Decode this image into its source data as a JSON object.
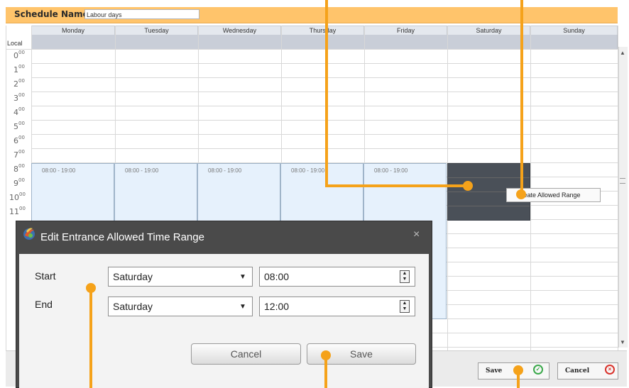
{
  "schedule": {
    "name_label": "Schedule Name:",
    "name_value": "Labour days"
  },
  "grid": {
    "local_label": "Local",
    "days": [
      "Monday",
      "Tuesday",
      "Wednesday",
      "Thursday",
      "Friday",
      "Saturday",
      "Sunday"
    ],
    "hours": [
      "0",
      "1",
      "2",
      "3",
      "4",
      "5",
      "6",
      "7",
      "8",
      "9",
      "10",
      "11"
    ],
    "hour_suffix": "00",
    "ranges": [
      {
        "day": "Monday",
        "label": "08:00 - 19:00"
      },
      {
        "day": "Tuesday",
        "label": "08:00 - 19:00"
      },
      {
        "day": "Wednesday",
        "label": "08:00 - 19:00"
      },
      {
        "day": "Thursday",
        "label": "08:00 - 19:00"
      },
      {
        "day": "Friday",
        "label": "08:00 - 19:00"
      }
    ]
  },
  "context_menu": {
    "item": "Create Allowed Range"
  },
  "toolbar": {
    "save_label": "Save",
    "cancel_label": "Cancel"
  },
  "dialog": {
    "title": "Edit Entrance Allowed Time Range",
    "close_glyph": "×",
    "start_label": "Start",
    "end_label": "End",
    "start_day": "Saturday",
    "end_day": "Saturday",
    "start_time": "08:00",
    "end_time": "12:00",
    "cancel_label": "Cancel",
    "save_label": "Save"
  },
  "colors": {
    "header_accent": "#ffc46b",
    "callout": "#f5a21a",
    "range_fill": "#e6f1fc",
    "selected_fill": "#4a5058",
    "save_icon": "#3aa84a",
    "cancel_icon": "#d9322b"
  },
  "icons": {
    "save": "check-circle-icon",
    "cancel": "close-circle-icon",
    "dialog": "app-logo-icon",
    "dropdown": "chevron-down-icon",
    "spinner": "spinner-updown-icon"
  }
}
